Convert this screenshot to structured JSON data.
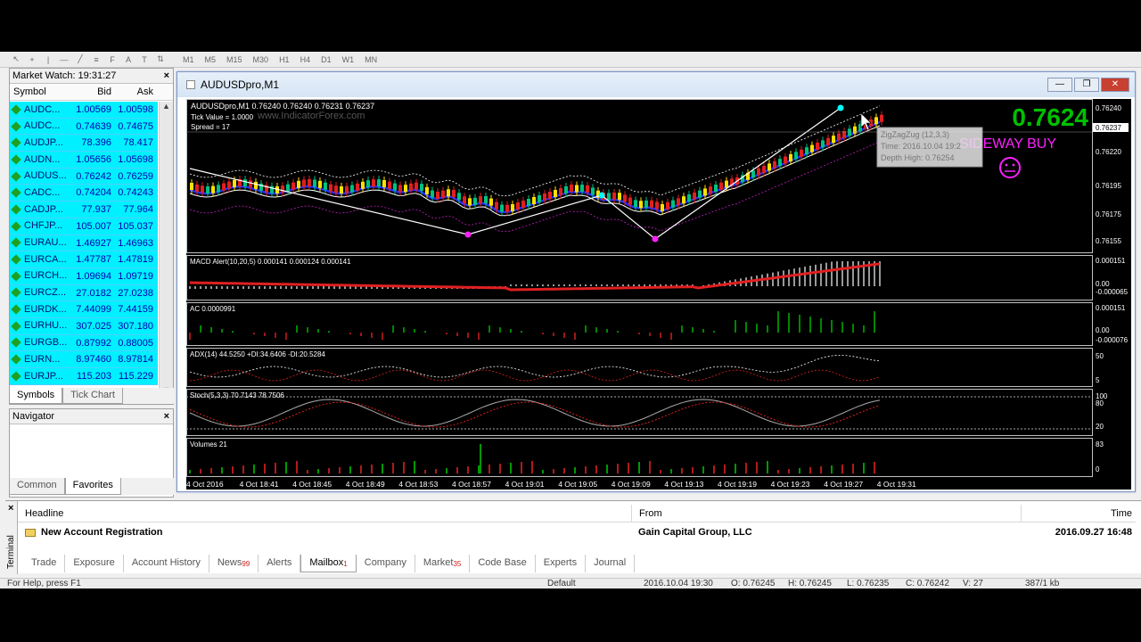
{
  "toolbar": {
    "timeframes": [
      "M1",
      "M5",
      "M15",
      "M30",
      "H1",
      "H4",
      "D1",
      "W1",
      "MN"
    ]
  },
  "market_watch": {
    "title": "Market Watch: 19:31:27",
    "col_symbol": "Symbol",
    "col_bid": "Bid",
    "col_ask": "Ask",
    "rows": [
      {
        "symbol": "AUDC...",
        "bid": "1.00569",
        "ask": "1.00598"
      },
      {
        "symbol": "AUDC...",
        "bid": "0.74639",
        "ask": "0.74675"
      },
      {
        "symbol": "AUDJP...",
        "bid": "78.396",
        "ask": "78.417"
      },
      {
        "symbol": "AUDN...",
        "bid": "1.05656",
        "ask": "1.05698"
      },
      {
        "symbol": "AUDUS...",
        "bid": "0.76242",
        "ask": "0.76259"
      },
      {
        "symbol": "CADC...",
        "bid": "0.74204",
        "ask": "0.74243"
      },
      {
        "symbol": "CADJP...",
        "bid": "77.937",
        "ask": "77.964"
      },
      {
        "symbol": "CHFJP...",
        "bid": "105.007",
        "ask": "105.037"
      },
      {
        "symbol": "EURAU...",
        "bid": "1.46927",
        "ask": "1.46963"
      },
      {
        "symbol": "EURCA...",
        "bid": "1.47787",
        "ask": "1.47819"
      },
      {
        "symbol": "EURCH...",
        "bid": "1.09694",
        "ask": "1.09719"
      },
      {
        "symbol": "EURCZ...",
        "bid": "27.0182",
        "ask": "27.0238"
      },
      {
        "symbol": "EURDK...",
        "bid": "7.44099",
        "ask": "7.44159"
      },
      {
        "symbol": "EURHU...",
        "bid": "307.025",
        "ask": "307.180"
      },
      {
        "symbol": "EURGB...",
        "bid": "0.87992",
        "ask": "0.88005"
      },
      {
        "symbol": "EURN...",
        "bid": "8.97460",
        "ask": "8.97814"
      },
      {
        "symbol": "EURJP...",
        "bid": "115.203",
        "ask": "115.229"
      }
    ],
    "tab_symbols": "Symbols",
    "tab_tick_chart": "Tick Chart"
  },
  "navigator": {
    "title": "Navigator",
    "tab_common": "Common",
    "tab_favorites": "Favorites"
  },
  "chart_window": {
    "title": "AUDUSDpro,M1",
    "header_line": "AUDUSDpro,M1  0.76240 0.76240 0.76231 0.76237",
    "watermark": "www.IndicatorForex.com",
    "tick_value": "Tick Value = 1.0000",
    "spread": "Spread = 17",
    "big_price": "0.7624",
    "signal": "SIDEWAY BUY",
    "tooltip_title": "ZigZagZug (12,3,3)",
    "tooltip_time": "Time: 2016.10.04 19:2",
    "tooltip_depth": "Depth High: 0.76254",
    "price_axis": [
      "0.76240",
      "0.76237",
      "0.76220",
      "0.76195",
      "0.76175",
      "0.76155"
    ],
    "macd_label": "MACD Alert(10,20,5) 0.000141 0.000124 0.000141",
    "macd_axis": [
      "0.000151",
      "0.00",
      "-0.000065"
    ],
    "ac_label": "AC 0.0000991",
    "ac_axis": [
      "0.000151",
      "0.00",
      "-0.000076"
    ],
    "adx_label": "ADX(14) 44.5250 +DI:34.6406 -DI:20.5284",
    "adx_axis": [
      "50",
      "5"
    ],
    "stoch_label": "Stoch(5,3,3) 70.7143 78.7506",
    "stoch_axis": [
      "100",
      "80",
      "20"
    ],
    "volume_label": "Volumes 21",
    "volume_axis": [
      "83",
      "0"
    ],
    "time_axis": [
      "4 Oct 2016",
      "4 Oct 18:41",
      "4 Oct 18:45",
      "4 Oct 18:49",
      "4 Oct 18:53",
      "4 Oct 18:57",
      "4 Oct 19:01",
      "4 Oct 19:05",
      "4 Oct 19:09",
      "4 Oct 19:13",
      "4 Oct 19:19",
      "4 Oct 19:23",
      "4 Oct 19:27",
      "4 Oct 19:31"
    ]
  },
  "terminal": {
    "side_label": "Terminal",
    "col_headline": "Headline",
    "col_from": "From",
    "col_time": "Time",
    "row_headline": "New Account Registration",
    "row_from": "Gain Capital Group, LLC",
    "row_time": "2016.09.27 16:48",
    "tabs": [
      {
        "label": "Trade",
        "badge": ""
      },
      {
        "label": "Exposure",
        "badge": ""
      },
      {
        "label": "Account History",
        "badge": ""
      },
      {
        "label": "News",
        "badge": "99"
      },
      {
        "label": "Alerts",
        "badge": ""
      },
      {
        "label": "Mailbox",
        "badge": "1"
      },
      {
        "label": "Company",
        "badge": ""
      },
      {
        "label": "Market",
        "badge": "35"
      },
      {
        "label": "Code Base",
        "badge": ""
      },
      {
        "label": "Experts",
        "badge": ""
      },
      {
        "label": "Journal",
        "badge": ""
      }
    ]
  },
  "status_bar": {
    "help": "For Help, press F1",
    "profile": "Default",
    "datetime": "2016.10.04 19:30",
    "open": "O: 0.76245",
    "high": "H: 0.76245",
    "low": "L: 0.76235",
    "close": "C: 0.76242",
    "volume": "V: 27",
    "traffic": "387/1 kb"
  },
  "colors": {
    "market_row_bg": "#00f0ff",
    "chart_bg": "#000000",
    "signal_magenta": "#ff20ff",
    "big_price_green": "#00c000"
  }
}
